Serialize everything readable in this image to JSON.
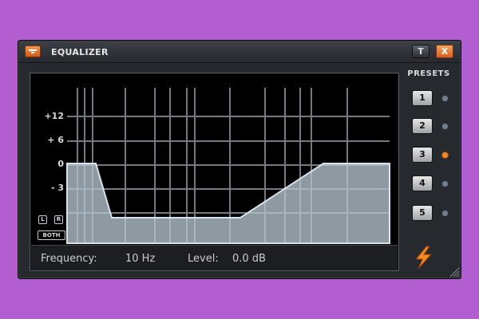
{
  "window": {
    "title": "EQUALIZER",
    "pin_label": "T",
    "close_label": "X"
  },
  "graph": {
    "y_labels": [
      "+12",
      "+ 6",
      "0",
      "- 3"
    ],
    "channel_left": "L",
    "channel_right": "R",
    "channel_both": "BOTH"
  },
  "status": {
    "frequency_label": "Frequency:",
    "frequency_value": "10 Hz",
    "level_label": "Level:",
    "level_value": "0.0 dB"
  },
  "presets": {
    "title": "PRESETS",
    "buttons": [
      "1",
      "2",
      "3",
      "4",
      "5"
    ],
    "active_index": 2
  },
  "colors": {
    "accent": "#f48a24",
    "curve_fill": "#b6c4d0",
    "background": "#b25ed0"
  }
}
